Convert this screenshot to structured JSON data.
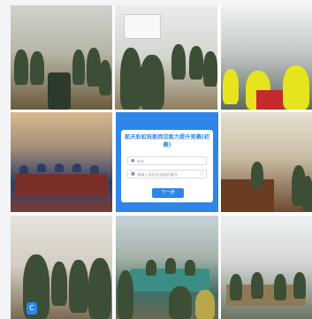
{
  "app": {
    "title": "航天彩虹技能岗位能力提升竞赛(初赛)",
    "name_placeholder": "姓名",
    "id_placeholder": "请输入身份证或组织编号",
    "next_label": "下一步",
    "accent_color": "#2f86e8"
  },
  "photos": [
    {
      "id": "classroom-top-left"
    },
    {
      "id": "classroom-top-middle"
    },
    {
      "id": "training-hall-top-right"
    },
    {
      "id": "auditorium-middle-left"
    },
    {
      "id": "office-middle-right"
    },
    {
      "id": "room-bottom-left"
    },
    {
      "id": "meeting-bottom-middle"
    },
    {
      "id": "hall-bottom-right"
    }
  ],
  "badge_glyph": "C"
}
